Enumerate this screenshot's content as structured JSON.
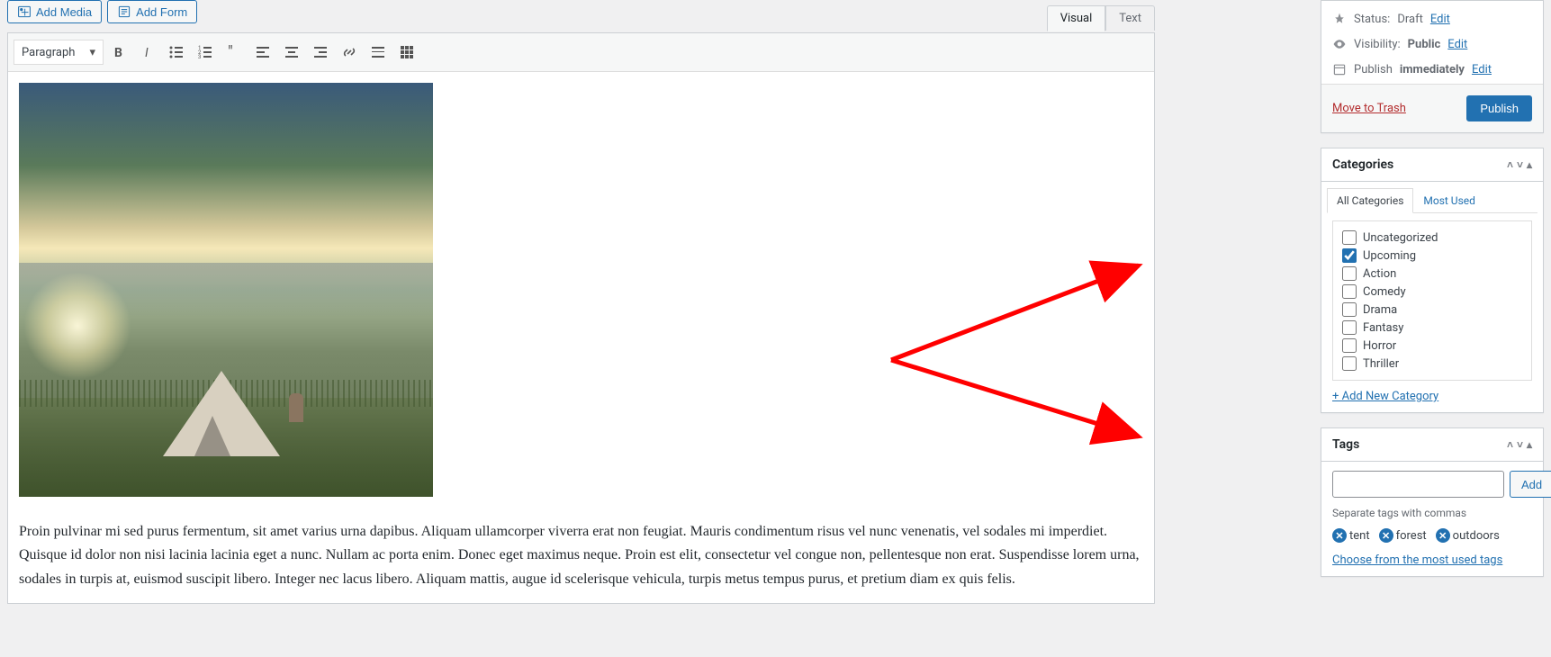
{
  "buttons": {
    "add_media": "Add Media",
    "add_form": "Add Form"
  },
  "editor": {
    "tabs": {
      "visual": "Visual",
      "text": "Text"
    },
    "format_dropdown": "Paragraph",
    "body_para": "Proin pulvinar mi sed purus fermentum, sit amet varius urna dapibus. Aliquam ullamcorper viverra erat non feugiat. Mauris condimentum risus vel nunc venenatis, vel sodales mi imperdiet. Quisque id dolor non nisi lacinia lacinia eget a nunc. Nullam ac porta enim. Donec eget maximus neque. Proin est elit, consectetur vel congue non, pellentesque non erat. Suspendisse lorem urna, sodales in turpis at, euismod suscipit libero. Integer nec lacus libero. Aliquam mattis, augue id scelerisque vehicula, turpis metus tempus purus, et pretium diam ex quis felis."
  },
  "publish_box": {
    "status_label": "Status:",
    "status_value": "Draft",
    "edit": "Edit",
    "visibility_label": "Visibility:",
    "visibility_value": "Public",
    "publish_label": "Publish",
    "publish_value": "immediately",
    "trash": "Move to Trash",
    "publish_button": "Publish"
  },
  "categories_box": {
    "title": "Categories",
    "tab_all": "All Categories",
    "tab_most": "Most Used",
    "items": [
      {
        "label": "Uncategorized",
        "checked": false
      },
      {
        "label": "Upcoming",
        "checked": true
      },
      {
        "label": "Action",
        "checked": false
      },
      {
        "label": "Comedy",
        "checked": false
      },
      {
        "label": "Drama",
        "checked": false
      },
      {
        "label": "Fantasy",
        "checked": false
      },
      {
        "label": "Horror",
        "checked": false
      },
      {
        "label": "Thriller",
        "checked": false
      }
    ],
    "add_new": "+ Add New Category"
  },
  "tags_box": {
    "title": "Tags",
    "add_button": "Add",
    "help": "Separate tags with commas",
    "tags": [
      "tent",
      "forest",
      "outdoors"
    ],
    "choose_link": "Choose from the most used tags"
  }
}
